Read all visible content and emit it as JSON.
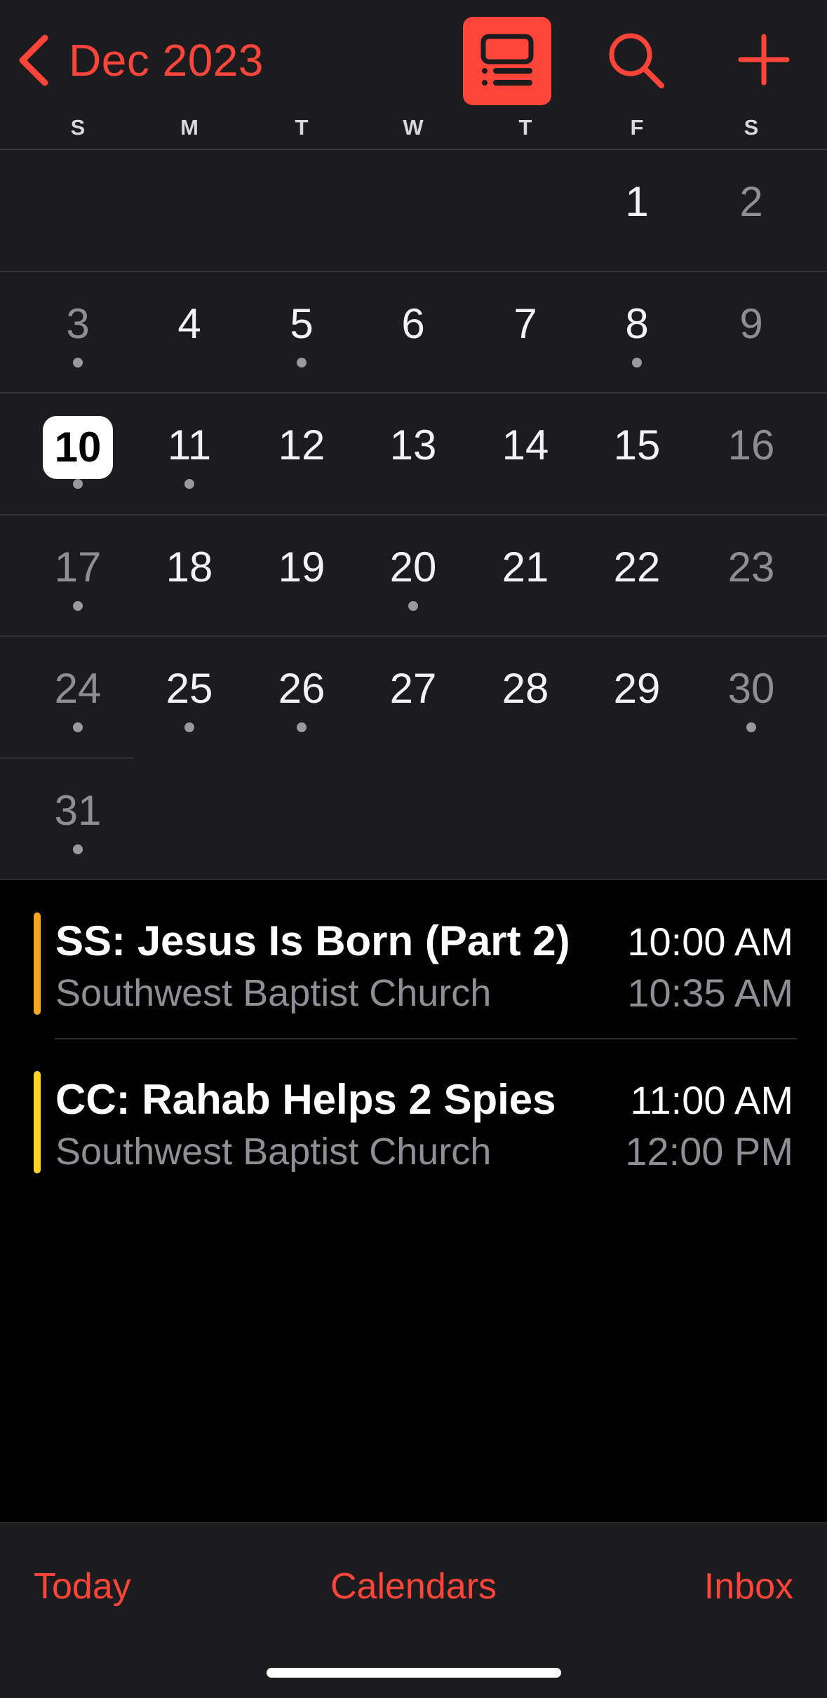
{
  "nav": {
    "month_title": "Dec 2023",
    "back_icon": "chevron-left-icon",
    "list_icon": "list-view-icon",
    "search_icon": "magnifier-icon",
    "add_icon": "plus-icon",
    "accent_color": "#ff453a"
  },
  "weekdays": [
    "S",
    "M",
    "T",
    "W",
    "T",
    "F",
    "S"
  ],
  "weeks": [
    [
      {
        "n": ""
      },
      {
        "n": ""
      },
      {
        "n": ""
      },
      {
        "n": ""
      },
      {
        "n": ""
      },
      {
        "n": "1",
        "dot": false
      },
      {
        "n": "2",
        "dot": false
      }
    ],
    [
      {
        "n": "3",
        "dot": true
      },
      {
        "n": "4",
        "dot": false
      },
      {
        "n": "5",
        "dot": true
      },
      {
        "n": "6",
        "dot": false
      },
      {
        "n": "7",
        "dot": false
      },
      {
        "n": "8",
        "dot": true
      },
      {
        "n": "9",
        "dot": false
      }
    ],
    [
      {
        "n": "10",
        "dot": true,
        "today": true
      },
      {
        "n": "11",
        "dot": true
      },
      {
        "n": "12",
        "dot": false
      },
      {
        "n": "13",
        "dot": false
      },
      {
        "n": "14",
        "dot": false
      },
      {
        "n": "15",
        "dot": false
      },
      {
        "n": "16",
        "dot": false
      }
    ],
    [
      {
        "n": "17",
        "dot": true
      },
      {
        "n": "18",
        "dot": false
      },
      {
        "n": "19",
        "dot": false
      },
      {
        "n": "20",
        "dot": true
      },
      {
        "n": "21",
        "dot": false
      },
      {
        "n": "22",
        "dot": false
      },
      {
        "n": "23",
        "dot": false
      }
    ],
    [
      {
        "n": "24",
        "dot": true
      },
      {
        "n": "25",
        "dot": true
      },
      {
        "n": "26",
        "dot": true
      },
      {
        "n": "27",
        "dot": false
      },
      {
        "n": "28",
        "dot": false
      },
      {
        "n": "29",
        "dot": false
      },
      {
        "n": "30",
        "dot": true
      }
    ],
    [
      {
        "n": "31",
        "dot": true
      },
      {
        "n": ""
      },
      {
        "n": ""
      },
      {
        "n": ""
      },
      {
        "n": ""
      },
      {
        "n": ""
      },
      {
        "n": ""
      }
    ]
  ],
  "events": [
    {
      "title": "SS: Jesus Is Born (Part 2)",
      "location": "Southwest Baptist Church",
      "start": "10:00 AM",
      "end": "10:35 AM",
      "color": "#f5a623"
    },
    {
      "title": "CC: Rahab Helps 2 Spies",
      "location": "Southwest Baptist Church",
      "start": "11:00 AM",
      "end": "12:00 PM",
      "color": "#ffd426"
    }
  ],
  "tabbar": {
    "today": "Today",
    "calendars": "Calendars",
    "inbox": "Inbox"
  }
}
